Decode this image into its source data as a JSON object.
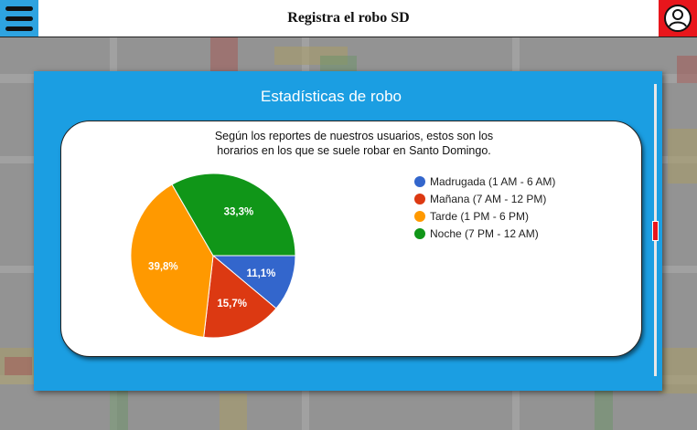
{
  "header": {
    "title": "Registra el robo SD"
  },
  "modal": {
    "title": "Estadísticas de robo",
    "description_line1": "Según los reportes de nuestros usuarios, estos son los",
    "description_line2": "horarios en los que se suele robar en Santo Domingo."
  },
  "chart_data": {
    "type": "pie",
    "title": "",
    "categories": [
      "Madrugada (1 AM - 6 AM)",
      "Mañana (7 AM - 12 PM)",
      "Tarde (1 PM - 6 PM)",
      "Noche (7 PM - 12 AM)"
    ],
    "values": [
      11.1,
      15.7,
      39.8,
      33.3
    ],
    "labels": [
      "11,1%",
      "15,7%",
      "39,8%",
      "33,3%"
    ],
    "colors": [
      "#3366cc",
      "#dc3912",
      "#ff9900",
      "#109618"
    ],
    "legend_position": "right"
  },
  "colors": {
    "menu_button": "#2ea3e0",
    "user_button": "#e8161c",
    "modal_background": "#1b9ee2"
  },
  "icons": {
    "menu": "hamburger-menu-icon",
    "user": "user-profile-icon"
  }
}
